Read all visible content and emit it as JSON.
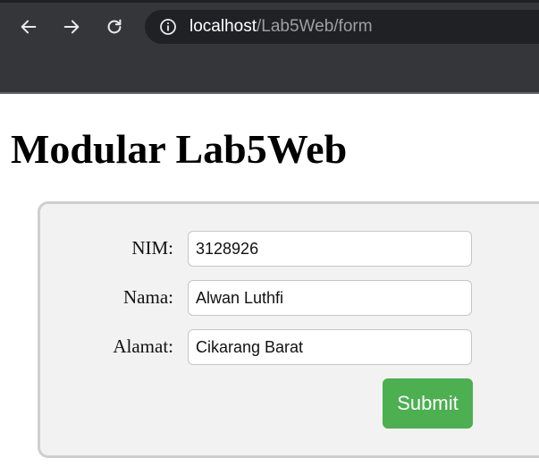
{
  "browser": {
    "url_host": "localhost",
    "url_path": "/Lab5Web/form",
    "icons": {
      "back": "arrow-left-icon",
      "forward": "arrow-right-icon",
      "reload": "reload-icon",
      "site_info": "info-icon"
    }
  },
  "page": {
    "title": "Modular Lab5Web"
  },
  "form": {
    "fields": [
      {
        "label": "NIM:",
        "value": "3128926"
      },
      {
        "label": "Nama:",
        "value": "Alwan Luthfi"
      },
      {
        "label": "Alamat:",
        "value": "Cikarang Barat"
      }
    ],
    "submit_label": "Submit"
  },
  "colors": {
    "chrome_bg": "#35363a",
    "omnibox_bg": "#202124",
    "submit_bg": "#4caf50",
    "form_bg": "#f2f2f2"
  }
}
